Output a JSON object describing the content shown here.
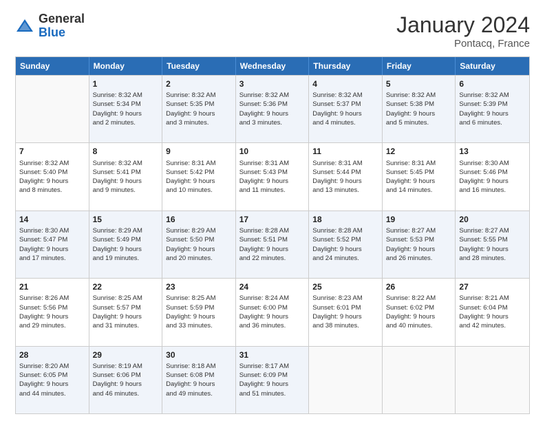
{
  "header": {
    "logo_general": "General",
    "logo_blue": "Blue",
    "month_title": "January 2024",
    "subtitle": "Pontacq, France"
  },
  "days_of_week": [
    "Sunday",
    "Monday",
    "Tuesday",
    "Wednesday",
    "Thursday",
    "Friday",
    "Saturday"
  ],
  "weeks": [
    [
      {
        "day": "",
        "text": ""
      },
      {
        "day": "1",
        "text": "Sunrise: 8:32 AM\nSunset: 5:34 PM\nDaylight: 9 hours\nand 2 minutes."
      },
      {
        "day": "2",
        "text": "Sunrise: 8:32 AM\nSunset: 5:35 PM\nDaylight: 9 hours\nand 3 minutes."
      },
      {
        "day": "3",
        "text": "Sunrise: 8:32 AM\nSunset: 5:36 PM\nDaylight: 9 hours\nand 3 minutes."
      },
      {
        "day": "4",
        "text": "Sunrise: 8:32 AM\nSunset: 5:37 PM\nDaylight: 9 hours\nand 4 minutes."
      },
      {
        "day": "5",
        "text": "Sunrise: 8:32 AM\nSunset: 5:38 PM\nDaylight: 9 hours\nand 5 minutes."
      },
      {
        "day": "6",
        "text": "Sunrise: 8:32 AM\nSunset: 5:39 PM\nDaylight: 9 hours\nand 6 minutes."
      }
    ],
    [
      {
        "day": "7",
        "text": "Sunrise: 8:32 AM\nSunset: 5:40 PM\nDaylight: 9 hours\nand 8 minutes."
      },
      {
        "day": "8",
        "text": "Sunrise: 8:32 AM\nSunset: 5:41 PM\nDaylight: 9 hours\nand 9 minutes."
      },
      {
        "day": "9",
        "text": "Sunrise: 8:31 AM\nSunset: 5:42 PM\nDaylight: 9 hours\nand 10 minutes."
      },
      {
        "day": "10",
        "text": "Sunrise: 8:31 AM\nSunset: 5:43 PM\nDaylight: 9 hours\nand 11 minutes."
      },
      {
        "day": "11",
        "text": "Sunrise: 8:31 AM\nSunset: 5:44 PM\nDaylight: 9 hours\nand 13 minutes."
      },
      {
        "day": "12",
        "text": "Sunrise: 8:31 AM\nSunset: 5:45 PM\nDaylight: 9 hours\nand 14 minutes."
      },
      {
        "day": "13",
        "text": "Sunrise: 8:30 AM\nSunset: 5:46 PM\nDaylight: 9 hours\nand 16 minutes."
      }
    ],
    [
      {
        "day": "14",
        "text": "Sunrise: 8:30 AM\nSunset: 5:47 PM\nDaylight: 9 hours\nand 17 minutes."
      },
      {
        "day": "15",
        "text": "Sunrise: 8:29 AM\nSunset: 5:49 PM\nDaylight: 9 hours\nand 19 minutes."
      },
      {
        "day": "16",
        "text": "Sunrise: 8:29 AM\nSunset: 5:50 PM\nDaylight: 9 hours\nand 20 minutes."
      },
      {
        "day": "17",
        "text": "Sunrise: 8:28 AM\nSunset: 5:51 PM\nDaylight: 9 hours\nand 22 minutes."
      },
      {
        "day": "18",
        "text": "Sunrise: 8:28 AM\nSunset: 5:52 PM\nDaylight: 9 hours\nand 24 minutes."
      },
      {
        "day": "19",
        "text": "Sunrise: 8:27 AM\nSunset: 5:53 PM\nDaylight: 9 hours\nand 26 minutes."
      },
      {
        "day": "20",
        "text": "Sunrise: 8:27 AM\nSunset: 5:55 PM\nDaylight: 9 hours\nand 28 minutes."
      }
    ],
    [
      {
        "day": "21",
        "text": "Sunrise: 8:26 AM\nSunset: 5:56 PM\nDaylight: 9 hours\nand 29 minutes."
      },
      {
        "day": "22",
        "text": "Sunrise: 8:25 AM\nSunset: 5:57 PM\nDaylight: 9 hours\nand 31 minutes."
      },
      {
        "day": "23",
        "text": "Sunrise: 8:25 AM\nSunset: 5:59 PM\nDaylight: 9 hours\nand 33 minutes."
      },
      {
        "day": "24",
        "text": "Sunrise: 8:24 AM\nSunset: 6:00 PM\nDaylight: 9 hours\nand 36 minutes."
      },
      {
        "day": "25",
        "text": "Sunrise: 8:23 AM\nSunset: 6:01 PM\nDaylight: 9 hours\nand 38 minutes."
      },
      {
        "day": "26",
        "text": "Sunrise: 8:22 AM\nSunset: 6:02 PM\nDaylight: 9 hours\nand 40 minutes."
      },
      {
        "day": "27",
        "text": "Sunrise: 8:21 AM\nSunset: 6:04 PM\nDaylight: 9 hours\nand 42 minutes."
      }
    ],
    [
      {
        "day": "28",
        "text": "Sunrise: 8:20 AM\nSunset: 6:05 PM\nDaylight: 9 hours\nand 44 minutes."
      },
      {
        "day": "29",
        "text": "Sunrise: 8:19 AM\nSunset: 6:06 PM\nDaylight: 9 hours\nand 46 minutes."
      },
      {
        "day": "30",
        "text": "Sunrise: 8:18 AM\nSunset: 6:08 PM\nDaylight: 9 hours\nand 49 minutes."
      },
      {
        "day": "31",
        "text": "Sunrise: 8:17 AM\nSunset: 6:09 PM\nDaylight: 9 hours\nand 51 minutes."
      },
      {
        "day": "",
        "text": ""
      },
      {
        "day": "",
        "text": ""
      },
      {
        "day": "",
        "text": ""
      }
    ]
  ]
}
